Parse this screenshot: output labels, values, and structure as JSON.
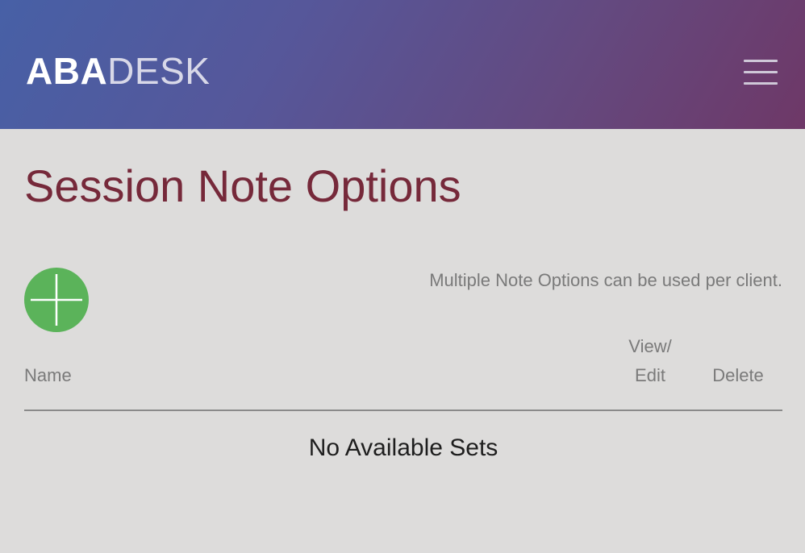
{
  "header": {
    "logo_bold": "ABA",
    "logo_light": "DESK",
    "menu_icon": "hamburger-menu-icon",
    "gradient_start": "#4760a6",
    "gradient_end": "#6e3867"
  },
  "main": {
    "title": "Session Note Options",
    "add_icon": "plus-icon",
    "add_color": "#5bb35a",
    "hint": "Multiple Note Options can be used per client.",
    "table": {
      "columns": [
        "Name",
        "View/\nEdit",
        "Delete"
      ],
      "empty_message": "No Available Sets"
    }
  }
}
